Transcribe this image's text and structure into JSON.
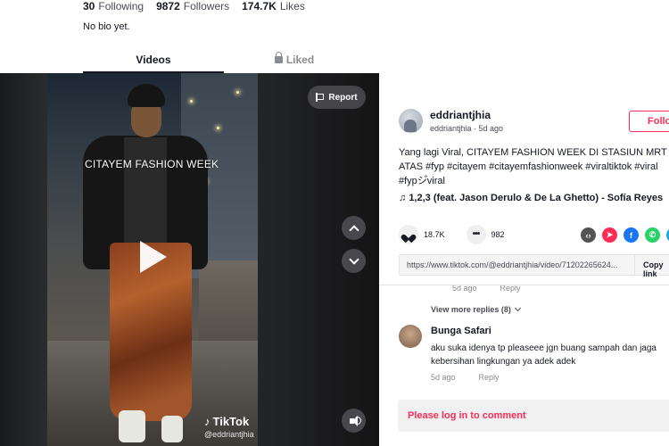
{
  "profile": {
    "following_count": "30",
    "following_label": "Following",
    "followers_count": "9872",
    "followers_label": "Followers",
    "likes_count": "174.7K",
    "likes_label": "Likes",
    "bio": "No bio yet.",
    "tabs": [
      {
        "label": "Videos",
        "active": true
      },
      {
        "label": "Liked",
        "active": false,
        "icon": "lock-icon"
      }
    ]
  },
  "player": {
    "overlay_text": "CITAYEM FASHION WEEK",
    "report_label": "Report",
    "watermark_brand": "TikTok",
    "watermark_user": "@eddriantjhia",
    "icons": [
      "flag-icon",
      "chevron-up-icon",
      "chevron-down-icon",
      "volume-icon",
      "play-icon"
    ]
  },
  "post": {
    "username": "eddriantjhia",
    "subline": "eddriantjhia · 5d ago",
    "follow_label": "Follow",
    "caption_lines": [
      "Yang lagi Viral, CITAYEM FASHION WEEK DI STASIUN MRT DUKU",
      "ATAS #fyp #citayem #citayemfashionweek #viraltiktok #viral",
      "#fypシ゚viral"
    ],
    "music": "1,2,3 (feat. Jason Derulo & De La Ghetto) - Sofía Reyes",
    "like_count": "18.7K",
    "comment_count": "982",
    "share_icons": [
      {
        "name": "embed-icon",
        "color": "#545454",
        "glyph": "‹›"
      },
      {
        "name": "send-icon",
        "color": "#fe2c55",
        "glyph": "➤"
      },
      {
        "name": "facebook-icon",
        "color": "#1877f2",
        "glyph": "f"
      },
      {
        "name": "whatsapp-icon",
        "color": "#25d366",
        "glyph": "✆"
      },
      {
        "name": "twitter-icon",
        "color": "#1da1f2",
        "glyph": "t"
      }
    ],
    "link": "https://www.tiktok.com/@eddriantjhia/video/71202265624...",
    "copy_label": "Copy link"
  },
  "comments": {
    "prev_meta": {
      "time": "5d ago",
      "reply": "Reply"
    },
    "view_more": "View more replies (8)",
    "items": [
      {
        "name": "Bunga Safari",
        "text": "aku suka idenya tp pleaseee jgn buang sampah dan jaga kebersihan lingkungan ya adek adek",
        "time": "5d ago",
        "reply": "Reply"
      }
    ]
  },
  "login_prompt": "Please log in to comment",
  "colors": {
    "accent": "#fe2c55",
    "text": "#161823",
    "muted": "#8a8b91"
  }
}
